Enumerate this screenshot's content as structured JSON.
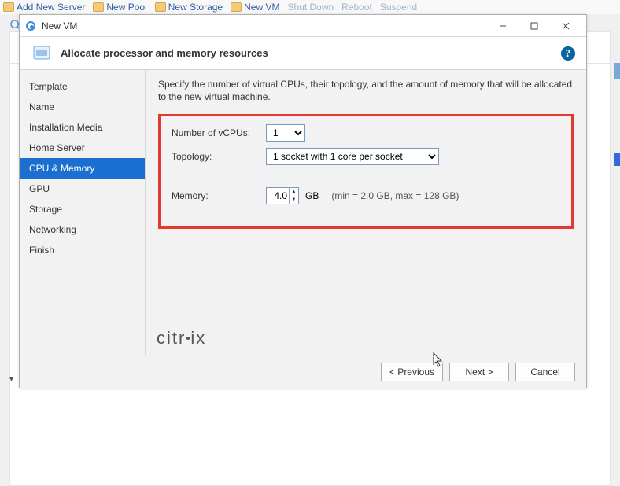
{
  "bg_toolbar": {
    "items": [
      "Add New Server",
      "New Pool",
      "New Storage",
      "New VM",
      "Shut Down",
      "Reboot",
      "Suspend"
    ]
  },
  "dialog": {
    "title": "New VM",
    "heading": "Allocate processor and memory resources",
    "help_label": "?"
  },
  "nav": {
    "items": [
      {
        "label": "Template",
        "active": false
      },
      {
        "label": "Name",
        "active": false
      },
      {
        "label": "Installation Media",
        "active": false
      },
      {
        "label": "Home Server",
        "active": false
      },
      {
        "label": "CPU & Memory",
        "active": true
      },
      {
        "label": "GPU",
        "active": false
      },
      {
        "label": "Storage",
        "active": false
      },
      {
        "label": "Networking",
        "active": false
      },
      {
        "label": "Finish",
        "active": false
      }
    ]
  },
  "content": {
    "description": "Specify the number of virtual CPUs, their topology, and the amount of memory that will be allocated to the new virtual machine.",
    "vcpus_label": "Number of vCPUs:",
    "vcpus_value": "1",
    "topology_label": "Topology:",
    "topology_value": "1 socket with 1 core per socket",
    "memory_label": "Memory:",
    "memory_value": "4.0",
    "memory_unit": "GB",
    "memory_hint": "(min = 2.0 GB, max = 128 GB)"
  },
  "brand": "citrix",
  "footer": {
    "prev": "< Previous",
    "next": "Next >",
    "cancel": "Cancel"
  }
}
